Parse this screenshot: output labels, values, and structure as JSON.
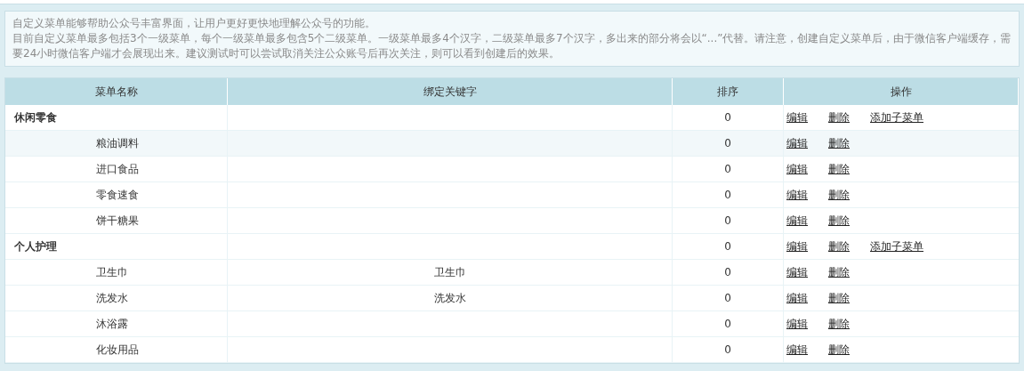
{
  "notice": [
    "自定义菜单能够帮助公众号丰富界面，让用户更好更快地理解公众号的功能。",
    "目前自定义菜单最多包括3个一级菜单，每个一级菜单最多包含5个二级菜单。一级菜单最多4个汉字，二级菜单最多7个汉字，多出来的部分将会以“...”代替。请注意，创建自定义菜单后，由于微信客户端缓存，需要24小时微信客户端才会展现出来。建议测试时可以尝试取消关注公众账号后再次关注，则可以看到创建后的效果。"
  ],
  "table": {
    "columns": [
      "菜单名称",
      "绑定关键字",
      "排序",
      "操作"
    ],
    "rows": [
      {
        "kind": "parent",
        "name": "休闲零食",
        "keyword": "",
        "order": "0",
        "hovered": false,
        "actions": [
          "编辑",
          "删除",
          "添加子菜单"
        ]
      },
      {
        "kind": "child",
        "name": "粮油调料",
        "keyword": "",
        "order": "0",
        "hovered": true,
        "actions": [
          "编辑",
          "删除"
        ]
      },
      {
        "kind": "child",
        "name": "进口食品",
        "keyword": "",
        "order": "0",
        "hovered": false,
        "actions": [
          "编辑",
          "删除"
        ]
      },
      {
        "kind": "child",
        "name": "零食速食",
        "keyword": "",
        "order": "0",
        "hovered": false,
        "actions": [
          "编辑",
          "删除"
        ]
      },
      {
        "kind": "child",
        "name": "饼干糖果",
        "keyword": "",
        "order": "0",
        "hovered": false,
        "actions": [
          "编辑",
          "删除"
        ]
      },
      {
        "kind": "parent",
        "name": "个人护理",
        "keyword": "",
        "order": "0",
        "hovered": false,
        "actions": [
          "编辑",
          "删除",
          "添加子菜单"
        ]
      },
      {
        "kind": "child",
        "name": "卫生巾",
        "keyword": "卫生巾",
        "order": "0",
        "hovered": false,
        "actions": [
          "编辑",
          "删除"
        ]
      },
      {
        "kind": "child",
        "name": "洗发水",
        "keyword": "洗发水",
        "order": "0",
        "hovered": false,
        "actions": [
          "编辑",
          "删除"
        ]
      },
      {
        "kind": "child",
        "name": "沐浴露",
        "keyword": "",
        "order": "0",
        "hovered": false,
        "actions": [
          "编辑",
          "删除"
        ]
      },
      {
        "kind": "child",
        "name": "化妆用品",
        "keyword": "",
        "order": "0",
        "hovered": false,
        "actions": [
          "编辑",
          "删除"
        ]
      }
    ]
  }
}
